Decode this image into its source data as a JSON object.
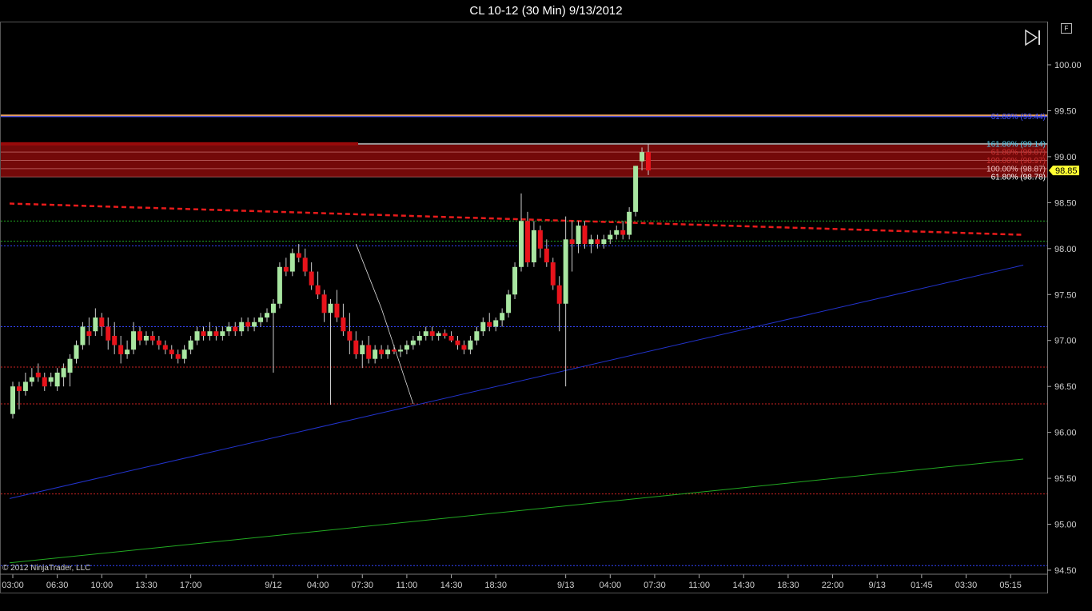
{
  "window": {
    "title": "CL 10-12 (30 Min)  9/13/2012"
  },
  "badges": {
    "f_label": "F"
  },
  "icons": {
    "play_end": "skip-to-end-icon"
  },
  "footer": {
    "copyright": "© 2012 NinjaTrader, LLC"
  },
  "colors": {
    "background": "#000000",
    "up_candle": "#a8e6a1",
    "down_candle": "#e8131b",
    "fib_fill": "#7a0a0a",
    "price_tag": "#ffff33"
  },
  "chart_data": {
    "type": "candlestick",
    "title": "CL 10-12 (30 Min)  9/13/2012",
    "ylim": [
      94.5,
      100.25
    ],
    "ytick_labels": [
      "100.00",
      "99.50",
      "99.00",
      "98.50",
      "98.00",
      "97.50",
      "97.00",
      "96.50",
      "96.00",
      "95.50",
      "95.00",
      "94.50"
    ],
    "x_ticks": [
      {
        "label": "03:00",
        "i": 0
      },
      {
        "label": "06:30",
        "i": 7
      },
      {
        "label": "10:00",
        "i": 14
      },
      {
        "label": "13:30",
        "i": 21
      },
      {
        "label": "17:00",
        "i": 28
      },
      {
        "label": "9/12",
        "i": 41
      },
      {
        "label": "04:00",
        "i": 48
      },
      {
        "label": "07:30",
        "i": 55
      },
      {
        "label": "11:00",
        "i": 62
      },
      {
        "label": "14:30",
        "i": 69
      },
      {
        "label": "18:30",
        "i": 76
      },
      {
        "label": "9/13",
        "i": 87
      },
      {
        "label": "04:00",
        "i": 94
      },
      {
        "label": "07:30",
        "i": 101
      },
      {
        "label": "11:00",
        "i": 108
      },
      {
        "label": "14:30",
        "i": 115
      },
      {
        "label": "18:30",
        "i": 122
      },
      {
        "label": "22:00",
        "i": 129
      },
      {
        "label": "9/13",
        "i": 136
      },
      {
        "label": "01:45",
        "i": 143
      },
      {
        "label": "03:30",
        "i": 150
      },
      {
        "label": "05:15",
        "i": 157
      }
    ],
    "candles": [
      [
        96.2,
        96.55,
        96.15,
        96.5
      ],
      [
        96.5,
        96.55,
        96.25,
        96.45
      ],
      [
        96.45,
        96.65,
        96.4,
        96.55
      ],
      [
        96.55,
        96.7,
        96.5,
        96.6
      ],
      [
        96.65,
        96.75,
        96.55,
        96.6
      ],
      [
        96.6,
        96.65,
        96.45,
        96.5
      ],
      [
        96.55,
        96.65,
        96.5,
        96.6
      ],
      [
        96.5,
        96.7,
        96.45,
        96.65
      ],
      [
        96.6,
        96.75,
        96.5,
        96.7
      ],
      [
        96.65,
        96.85,
        96.5,
        96.8
      ],
      [
        96.8,
        97.0,
        96.75,
        96.95
      ],
      [
        96.95,
        97.2,
        96.9,
        97.15
      ],
      [
        97.1,
        97.25,
        96.95,
        97.05
      ],
      [
        97.1,
        97.35,
        97.05,
        97.25
      ],
      [
        97.25,
        97.3,
        97.05,
        97.15
      ],
      [
        97.15,
        97.25,
        96.9,
        97.0
      ],
      [
        97.05,
        97.2,
        96.85,
        96.95
      ],
      [
        96.95,
        97.05,
        96.75,
        96.85
      ],
      [
        96.85,
        97.0,
        96.8,
        96.9
      ],
      [
        96.9,
        97.2,
        96.85,
        97.1
      ],
      [
        97.1,
        97.15,
        96.95,
        97.0
      ],
      [
        97.0,
        97.1,
        96.95,
        97.05
      ],
      [
        97.05,
        97.1,
        96.95,
        97.0
      ],
      [
        97.0,
        97.05,
        96.9,
        96.95
      ],
      [
        96.95,
        97.0,
        96.85,
        96.9
      ],
      [
        96.9,
        96.95,
        96.8,
        96.85
      ],
      [
        96.85,
        96.9,
        96.75,
        96.8
      ],
      [
        96.8,
        96.95,
        96.75,
        96.9
      ],
      [
        96.9,
        97.05,
        96.85,
        97.0
      ],
      [
        97.0,
        97.15,
        96.95,
        97.1
      ],
      [
        97.1,
        97.15,
        97.0,
        97.05
      ],
      [
        97.05,
        97.2,
        97.0,
        97.1
      ],
      [
        97.1,
        97.15,
        97.0,
        97.05
      ],
      [
        97.05,
        97.15,
        97.0,
        97.1
      ],
      [
        97.1,
        97.2,
        97.05,
        97.15
      ],
      [
        97.15,
        97.2,
        97.05,
        97.1
      ],
      [
        97.1,
        97.25,
        97.05,
        97.2
      ],
      [
        97.2,
        97.25,
        97.1,
        97.15
      ],
      [
        97.15,
        97.25,
        97.1,
        97.2
      ],
      [
        97.2,
        97.3,
        97.15,
        97.25
      ],
      [
        97.25,
        97.35,
        97.2,
        97.3
      ],
      [
        97.3,
        97.45,
        96.65,
        97.4
      ],
      [
        97.4,
        97.85,
        97.35,
        97.8
      ],
      [
        97.8,
        97.9,
        97.7,
        97.75
      ],
      [
        97.75,
        98.0,
        97.7,
        97.95
      ],
      [
        97.95,
        98.05,
        97.85,
        97.9
      ],
      [
        97.9,
        98.0,
        97.7,
        97.75
      ],
      [
        97.75,
        97.85,
        97.55,
        97.6
      ],
      [
        97.6,
        97.75,
        97.45,
        97.5
      ],
      [
        97.5,
        97.55,
        97.2,
        97.3
      ],
      [
        97.3,
        97.45,
        96.3,
        97.4
      ],
      [
        97.4,
        97.55,
        97.2,
        97.25
      ],
      [
        97.25,
        97.4,
        97.05,
        97.1
      ],
      [
        97.1,
        97.3,
        96.85,
        97.0
      ],
      [
        97.0,
        97.1,
        96.8,
        96.85
      ],
      [
        96.85,
        97.0,
        96.7,
        96.95
      ],
      [
        96.95,
        97.05,
        96.75,
        96.8
      ],
      [
        96.8,
        96.95,
        96.75,
        96.9
      ],
      [
        96.9,
        96.95,
        96.8,
        96.85
      ],
      [
        96.85,
        96.95,
        96.8,
        96.9
      ],
      [
        96.9,
        96.95,
        96.85,
        96.88
      ],
      [
        96.88,
        96.95,
        96.82,
        96.9
      ],
      [
        96.9,
        97.0,
        96.85,
        96.95
      ],
      [
        96.95,
        97.05,
        96.9,
        97.0
      ],
      [
        97.0,
        97.1,
        96.95,
        97.05
      ],
      [
        97.05,
        97.15,
        97.0,
        97.1
      ],
      [
        97.1,
        97.15,
        97.0,
        97.05
      ],
      [
        97.05,
        97.1,
        97.0,
        97.08
      ],
      [
        97.08,
        97.12,
        97.02,
        97.05
      ],
      [
        97.05,
        97.1,
        96.98,
        97.0
      ],
      [
        97.0,
        97.05,
        96.9,
        96.95
      ],
      [
        96.95,
        97.0,
        96.85,
        96.9
      ],
      [
        96.9,
        97.05,
        96.85,
        97.0
      ],
      [
        97.0,
        97.15,
        96.95,
        97.1
      ],
      [
        97.1,
        97.25,
        97.05,
        97.2
      ],
      [
        97.2,
        97.3,
        97.1,
        97.15
      ],
      [
        97.15,
        97.25,
        97.1,
        97.22
      ],
      [
        97.22,
        97.35,
        97.15,
        97.3
      ],
      [
        97.3,
        97.55,
        97.25,
        97.5
      ],
      [
        97.5,
        97.85,
        97.45,
        97.8
      ],
      [
        97.8,
        98.6,
        97.75,
        98.3
      ],
      [
        98.3,
        98.4,
        97.8,
        97.85
      ],
      [
        97.85,
        98.3,
        97.8,
        98.2
      ],
      [
        98.2,
        98.25,
        97.9,
        98.0
      ],
      [
        98.0,
        98.1,
        97.8,
        97.85
      ],
      [
        97.85,
        97.9,
        97.55,
        97.6
      ],
      [
        97.6,
        97.7,
        97.1,
        97.4
      ],
      [
        97.4,
        98.35,
        96.5,
        98.1
      ],
      [
        98.1,
        98.3,
        97.75,
        98.05
      ],
      [
        98.05,
        98.3,
        97.95,
        98.25
      ],
      [
        98.25,
        98.3,
        98.0,
        98.05
      ],
      [
        98.05,
        98.15,
        97.95,
        98.1
      ],
      [
        98.1,
        98.15,
        98.0,
        98.05
      ],
      [
        98.05,
        98.15,
        98.0,
        98.1
      ],
      [
        98.1,
        98.2,
        98.05,
        98.15
      ],
      [
        98.15,
        98.25,
        98.1,
        98.2
      ],
      [
        98.2,
        98.3,
        98.1,
        98.15
      ],
      [
        98.15,
        98.45,
        98.1,
        98.4
      ],
      [
        98.4,
        98.9,
        98.35,
        98.9
      ],
      [
        98.95,
        99.1,
        98.85,
        99.05
      ],
      [
        99.05,
        99.14,
        98.8,
        98.85
      ]
    ],
    "horizontal_lines": [
      {
        "price": 99.44,
        "color": "#3344ff"
      },
      {
        "price": 99.45,
        "color": "#e8a060"
      },
      {
        "price": 98.3,
        "color": "#22aa22"
      },
      {
        "price": 98.08,
        "color": "#22aa22"
      },
      {
        "price": 98.03,
        "color": "#3344ff"
      },
      {
        "price": 97.15,
        "color": "#3344ff"
      },
      {
        "price": 96.71,
        "color": "#cc2222"
      },
      {
        "price": 96.31,
        "color": "#cc2222"
      },
      {
        "price": 95.33,
        "color": "#cc2222"
      },
      {
        "price": 94.55,
        "color": "#3344ff"
      }
    ],
    "fib_zone": {
      "from": 98.78,
      "to": 99.14
    },
    "fib_labels": [
      {
        "text": "61.80% (99.44)",
        "price": 99.44,
        "color": "#4455ff"
      },
      {
        "text": "161.80% (99.14)",
        "price": 99.14,
        "color": "#55ccee"
      },
      {
        "text": "61.80% (99.07)",
        "price": 99.05,
        "color": "#cc3333"
      },
      {
        "text": "100.00% (98.97)",
        "price": 98.96,
        "color": "#cc3333"
      },
      {
        "text": "100.00% (98.87)",
        "price": 98.87,
        "color": "#f0c0c0"
      },
      {
        "text": "61.80% (98.78)",
        "price": 98.78,
        "color": "#ffffff"
      }
    ],
    "trend_lines": [
      {
        "name": "red-dashed-trendline",
        "from": [
          -0.5,
          98.49
        ],
        "to": [
          159,
          98.15
        ],
        "color": "#e81b1b",
        "dash": true
      },
      {
        "name": "blue-trendline",
        "from": [
          -0.5,
          95.28
        ],
        "to": [
          159,
          97.82
        ],
        "color": "#2233cc",
        "dash": false
      },
      {
        "name": "green-trendline",
        "from": [
          -0.5,
          94.58
        ],
        "to": [
          159,
          95.71
        ],
        "color": "#22aa22",
        "dash": false
      }
    ],
    "last_price": "98.85"
  }
}
